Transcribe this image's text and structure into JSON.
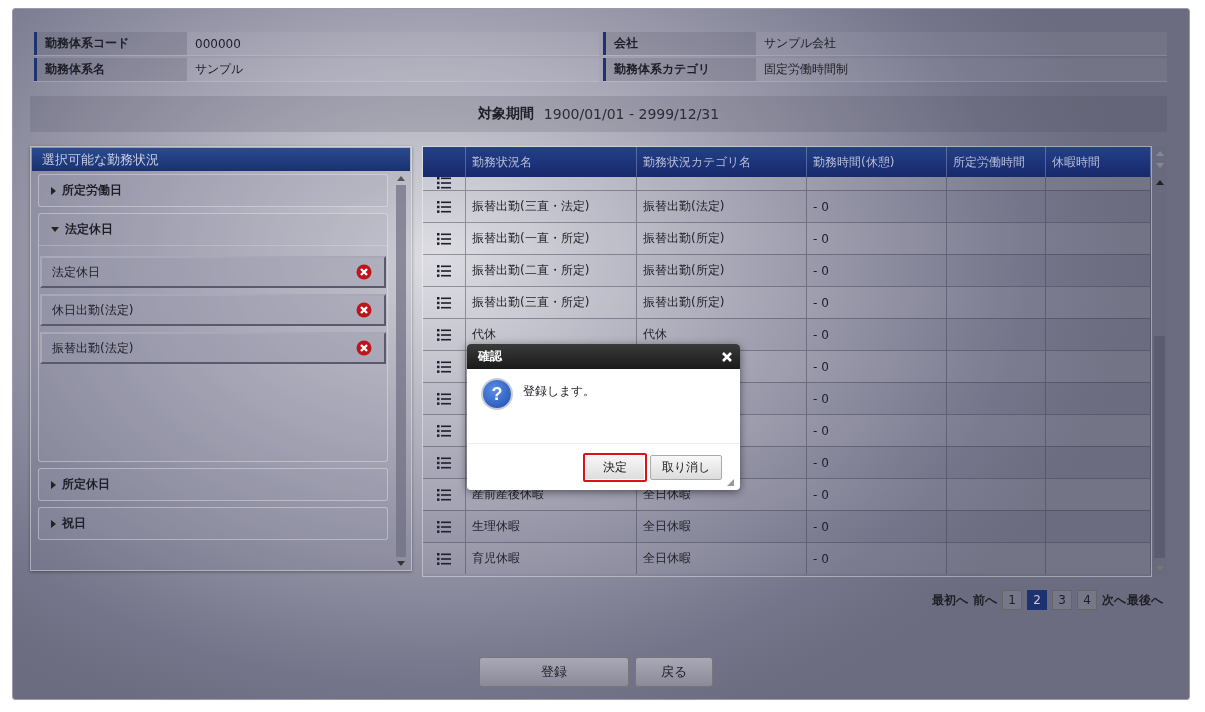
{
  "info": [
    {
      "label": "勤務体系コード",
      "value": "000000"
    },
    {
      "label": "会社",
      "value": "サンプル会社"
    },
    {
      "label": "勤務体系名",
      "value": "サンプル"
    },
    {
      "label": "勤務体系カテゴリ",
      "value": "固定労働時間制"
    }
  ],
  "period": {
    "label": "対象期間",
    "value": "1900/01/01 - 2999/12/31"
  },
  "available_panel": {
    "title": "選択可能な勤務状況",
    "groups": [
      {
        "label": "所定労働日",
        "expanded": false
      },
      {
        "label": "法定休日",
        "expanded": true,
        "items": [
          "法定休日",
          "休日出勤(法定)",
          "振替出勤(法定)"
        ]
      },
      {
        "label": "所定休日",
        "expanded": false
      },
      {
        "label": "祝日",
        "expanded": false
      }
    ]
  },
  "table": {
    "columns": [
      "勤務状況名",
      "勤務状況カテゴリ名",
      "勤務時間(休憩)",
      "所定労働時間",
      "休暇時間"
    ],
    "rows": [
      {
        "clipped": true
      },
      {
        "name": "振替出勤(三直・法定)",
        "category": "振替出勤(法定)",
        "work_time": "- 0"
      },
      {
        "name": "振替出勤(一直・所定)",
        "category": "振替出勤(所定)",
        "work_time": "- 0"
      },
      {
        "name": "振替出勤(二直・所定)",
        "category": "振替出勤(所定)",
        "work_time": "- 0"
      },
      {
        "name": "振替出勤(三直・所定)",
        "category": "振替出勤(所定)",
        "work_time": "- 0"
      },
      {
        "name": "代休",
        "category": "代休",
        "work_time": "- 0"
      },
      {
        "work_time": "- 0"
      },
      {
        "work_time": "- 0"
      },
      {
        "work_time": "- 0"
      },
      {
        "work_time": "- 0"
      },
      {
        "name": "産前産後休暇",
        "category": "全日休暇",
        "work_time": "- 0"
      },
      {
        "name": "生理休暇",
        "category": "全日休暇",
        "work_time": "- 0"
      },
      {
        "name": "育児休暇",
        "category": "全日休暇",
        "work_time": "- 0"
      }
    ]
  },
  "pagination": {
    "first": "最初へ",
    "prev": "前へ",
    "pages": [
      {
        "label": "1",
        "selected": false
      },
      {
        "label": "2",
        "selected": true
      },
      {
        "label": "3",
        "selected": false
      },
      {
        "label": "4",
        "selected": false
      }
    ],
    "next": "次へ",
    "last": "最後へ"
  },
  "buttons": [
    "登録",
    "戻る"
  ],
  "dialog": {
    "title": "確認",
    "icon": "?",
    "message": "登録します。",
    "buttons": [
      {
        "label": "決定",
        "focused": true
      },
      {
        "label": "取り消し",
        "focused": false
      }
    ]
  }
}
